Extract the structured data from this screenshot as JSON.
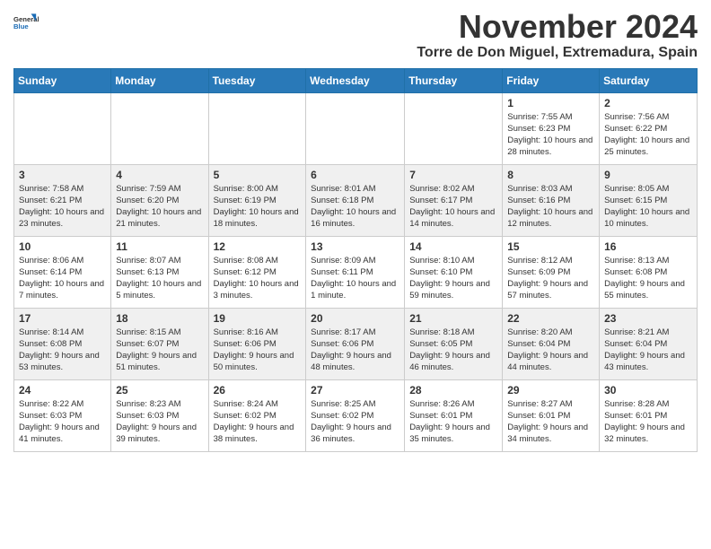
{
  "header": {
    "logo": {
      "general": "General",
      "blue": "Blue"
    },
    "month_title": "November 2024",
    "location": "Torre de Don Miguel, Extremadura, Spain"
  },
  "calendar": {
    "days_of_week": [
      "Sunday",
      "Monday",
      "Tuesday",
      "Wednesday",
      "Thursday",
      "Friday",
      "Saturday"
    ],
    "weeks": [
      [
        {
          "day": "",
          "info": ""
        },
        {
          "day": "",
          "info": ""
        },
        {
          "day": "",
          "info": ""
        },
        {
          "day": "",
          "info": ""
        },
        {
          "day": "",
          "info": ""
        },
        {
          "day": "1",
          "info": "Sunrise: 7:55 AM\nSunset: 6:23 PM\nDaylight: 10 hours and 28 minutes."
        },
        {
          "day": "2",
          "info": "Sunrise: 7:56 AM\nSunset: 6:22 PM\nDaylight: 10 hours and 25 minutes."
        }
      ],
      [
        {
          "day": "3",
          "info": "Sunrise: 7:58 AM\nSunset: 6:21 PM\nDaylight: 10 hours and 23 minutes."
        },
        {
          "day": "4",
          "info": "Sunrise: 7:59 AM\nSunset: 6:20 PM\nDaylight: 10 hours and 21 minutes."
        },
        {
          "day": "5",
          "info": "Sunrise: 8:00 AM\nSunset: 6:19 PM\nDaylight: 10 hours and 18 minutes."
        },
        {
          "day": "6",
          "info": "Sunrise: 8:01 AM\nSunset: 6:18 PM\nDaylight: 10 hours and 16 minutes."
        },
        {
          "day": "7",
          "info": "Sunrise: 8:02 AM\nSunset: 6:17 PM\nDaylight: 10 hours and 14 minutes."
        },
        {
          "day": "8",
          "info": "Sunrise: 8:03 AM\nSunset: 6:16 PM\nDaylight: 10 hours and 12 minutes."
        },
        {
          "day": "9",
          "info": "Sunrise: 8:05 AM\nSunset: 6:15 PM\nDaylight: 10 hours and 10 minutes."
        }
      ],
      [
        {
          "day": "10",
          "info": "Sunrise: 8:06 AM\nSunset: 6:14 PM\nDaylight: 10 hours and 7 minutes."
        },
        {
          "day": "11",
          "info": "Sunrise: 8:07 AM\nSunset: 6:13 PM\nDaylight: 10 hours and 5 minutes."
        },
        {
          "day": "12",
          "info": "Sunrise: 8:08 AM\nSunset: 6:12 PM\nDaylight: 10 hours and 3 minutes."
        },
        {
          "day": "13",
          "info": "Sunrise: 8:09 AM\nSunset: 6:11 PM\nDaylight: 10 hours and 1 minute."
        },
        {
          "day": "14",
          "info": "Sunrise: 8:10 AM\nSunset: 6:10 PM\nDaylight: 9 hours and 59 minutes."
        },
        {
          "day": "15",
          "info": "Sunrise: 8:12 AM\nSunset: 6:09 PM\nDaylight: 9 hours and 57 minutes."
        },
        {
          "day": "16",
          "info": "Sunrise: 8:13 AM\nSunset: 6:08 PM\nDaylight: 9 hours and 55 minutes."
        }
      ],
      [
        {
          "day": "17",
          "info": "Sunrise: 8:14 AM\nSunset: 6:08 PM\nDaylight: 9 hours and 53 minutes."
        },
        {
          "day": "18",
          "info": "Sunrise: 8:15 AM\nSunset: 6:07 PM\nDaylight: 9 hours and 51 minutes."
        },
        {
          "day": "19",
          "info": "Sunrise: 8:16 AM\nSunset: 6:06 PM\nDaylight: 9 hours and 50 minutes."
        },
        {
          "day": "20",
          "info": "Sunrise: 8:17 AM\nSunset: 6:06 PM\nDaylight: 9 hours and 48 minutes."
        },
        {
          "day": "21",
          "info": "Sunrise: 8:18 AM\nSunset: 6:05 PM\nDaylight: 9 hours and 46 minutes."
        },
        {
          "day": "22",
          "info": "Sunrise: 8:20 AM\nSunset: 6:04 PM\nDaylight: 9 hours and 44 minutes."
        },
        {
          "day": "23",
          "info": "Sunrise: 8:21 AM\nSunset: 6:04 PM\nDaylight: 9 hours and 43 minutes."
        }
      ],
      [
        {
          "day": "24",
          "info": "Sunrise: 8:22 AM\nSunset: 6:03 PM\nDaylight: 9 hours and 41 minutes."
        },
        {
          "day": "25",
          "info": "Sunrise: 8:23 AM\nSunset: 6:03 PM\nDaylight: 9 hours and 39 minutes."
        },
        {
          "day": "26",
          "info": "Sunrise: 8:24 AM\nSunset: 6:02 PM\nDaylight: 9 hours and 38 minutes."
        },
        {
          "day": "27",
          "info": "Sunrise: 8:25 AM\nSunset: 6:02 PM\nDaylight: 9 hours and 36 minutes."
        },
        {
          "day": "28",
          "info": "Sunrise: 8:26 AM\nSunset: 6:01 PM\nDaylight: 9 hours and 35 minutes."
        },
        {
          "day": "29",
          "info": "Sunrise: 8:27 AM\nSunset: 6:01 PM\nDaylight: 9 hours and 34 minutes."
        },
        {
          "day": "30",
          "info": "Sunrise: 8:28 AM\nSunset: 6:01 PM\nDaylight: 9 hours and 32 minutes."
        }
      ]
    ]
  }
}
